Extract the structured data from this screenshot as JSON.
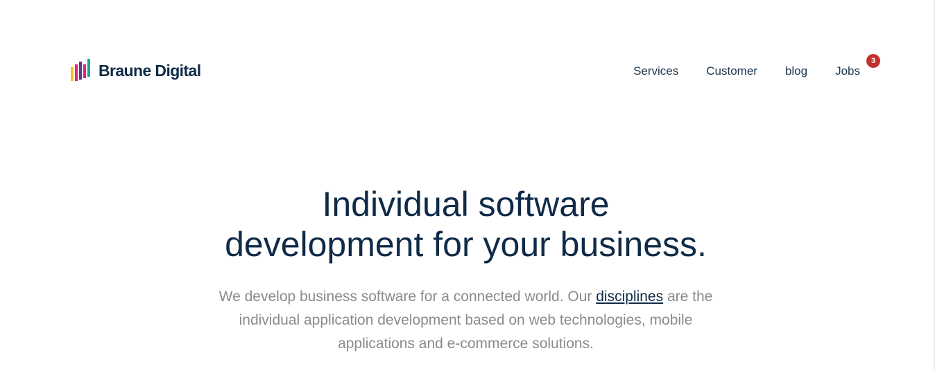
{
  "logo": {
    "text": "Braune Digital",
    "icon": "logo-bars-icon",
    "colors": [
      "#f5c518",
      "#e2247a",
      "#5a3d8f",
      "#1aa69b"
    ]
  },
  "nav": {
    "items": [
      {
        "label": "Services"
      },
      {
        "label": "Customer"
      },
      {
        "label": "blog"
      },
      {
        "label": "Jobs",
        "badge": "3"
      }
    ]
  },
  "hero": {
    "title_line1": "Individual software",
    "title_line2": "development for your business.",
    "subtitle_before": "We develop business software for a connected world. Our ",
    "subtitle_link": "disciplines",
    "subtitle_after": " are the individual application development based on web technologies, mobile applications and e-commerce solutions."
  },
  "colors": {
    "primary": "#0f2b48",
    "muted_text": "#8a8a8a",
    "badge": "#c4312c"
  }
}
